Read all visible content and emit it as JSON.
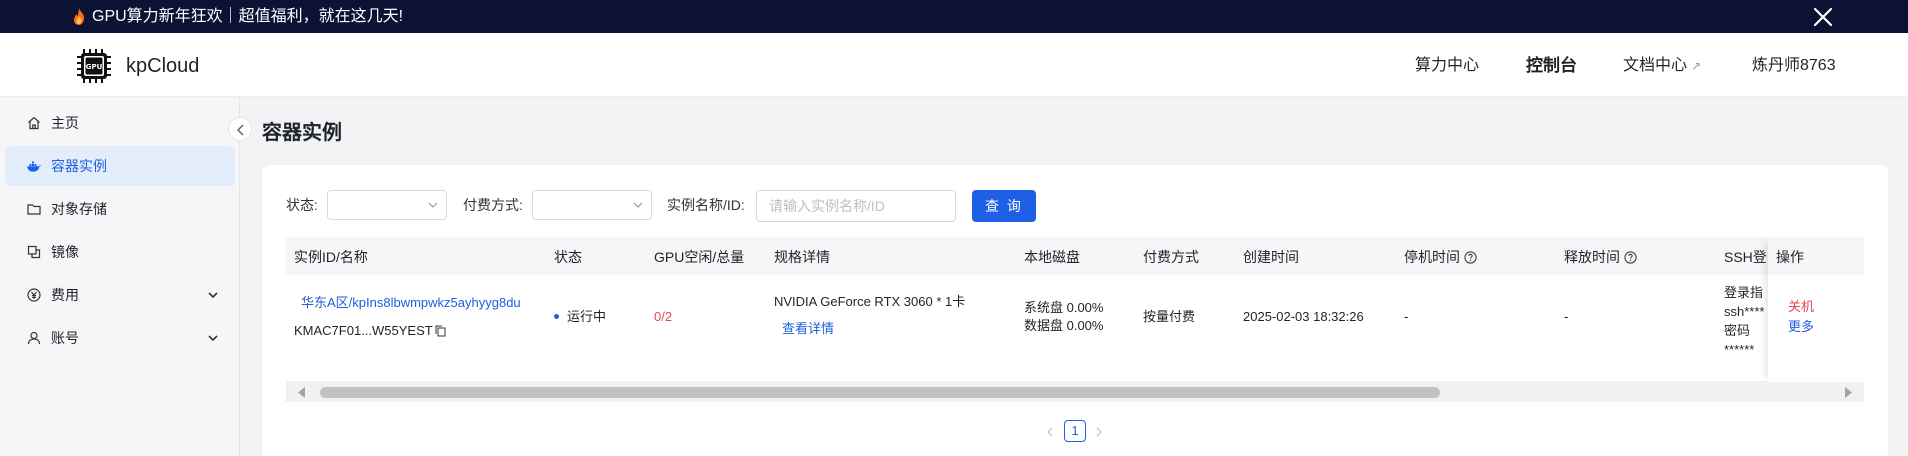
{
  "banner": {
    "text": "GPU算力新年狂欢｜超值福利，就在这几天!"
  },
  "header": {
    "logo_chip_text": "GPU",
    "logo_text": "kpCloud",
    "nav": {
      "compute": "算力中心",
      "console": "控制台",
      "docs": "文档中心",
      "docs_icon": "↗",
      "user": "炼丹师8763"
    }
  },
  "sidebar": {
    "items": [
      {
        "label": "主页"
      },
      {
        "label": "容器实例"
      },
      {
        "label": "对象存储"
      },
      {
        "label": "镜像"
      },
      {
        "label": "费用"
      },
      {
        "label": "账号"
      }
    ]
  },
  "page": {
    "title": "容器实例"
  },
  "filters": {
    "status_label": "状态:",
    "pay_label": "付费方式:",
    "name_label": "实例名称/ID:",
    "name_placeholder": "请输入实例名称/ID",
    "query_button": "查 询"
  },
  "table": {
    "headers": {
      "id": "实例ID/名称",
      "status": "状态",
      "gpu": "GPU空闲/总量",
      "spec": "规格详情",
      "disk": "本地磁盘",
      "pay": "付费方式",
      "created": "创建时间",
      "stop": "停机时间",
      "release": "释放时间",
      "ssh": "SSH登",
      "ops": "操作"
    },
    "rows": [
      {
        "name": "华东A区/kpIns8lbwmpwkz5ayhyyg8du",
        "id": "KMAC7F01...W55YEST",
        "status": "运行中",
        "gpu": "0/2",
        "spec": "NVIDIA GeForce RTX 3060 * 1卡",
        "spec_link": "查看详情",
        "disk_sys": "系统盘 0.00%",
        "disk_data": "数据盘 0.00%",
        "pay": "按量付费",
        "created": "2025-02-03 18:32:26",
        "stop": "-",
        "release": "-",
        "ssh_line1": "登录指",
        "ssh_line2": "ssh****",
        "ssh_line3": "密码",
        "ssh_line4": "******",
        "op_shutdown": "关机",
        "op_more": "更多"
      }
    ]
  },
  "pagination": {
    "current": "1"
  },
  "colors": {
    "primary": "#1f5fe6",
    "banner_bg": "#0c1233",
    "danger": "#e6464e"
  }
}
